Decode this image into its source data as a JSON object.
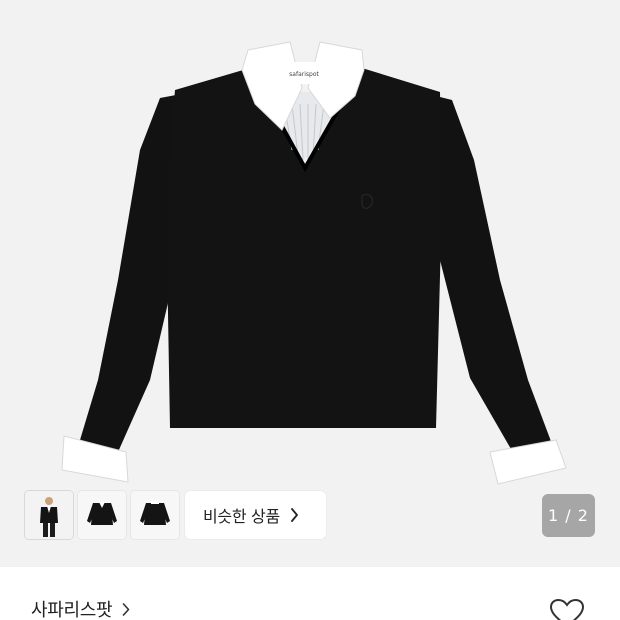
{
  "product": {
    "collar_logo": "safarispot",
    "image_count_label": "1 / 2"
  },
  "thumbnails": [
    {
      "name": "model-photo"
    },
    {
      "name": "front-view"
    },
    {
      "name": "back-view"
    }
  ],
  "similar_button": {
    "label": "비슷한 상품"
  },
  "brand": {
    "name": "사파리스팟"
  },
  "colors": {
    "hero_bg": "#f2f2f2",
    "sweater": "#111111",
    "collar": "#ffffff",
    "pager_bg": "#a6a6a6"
  },
  "icons": {
    "similar_chevron": "chevron-right-icon",
    "brand_chevron": "chevron-right-icon",
    "wishlist": "heart-outline-icon"
  }
}
